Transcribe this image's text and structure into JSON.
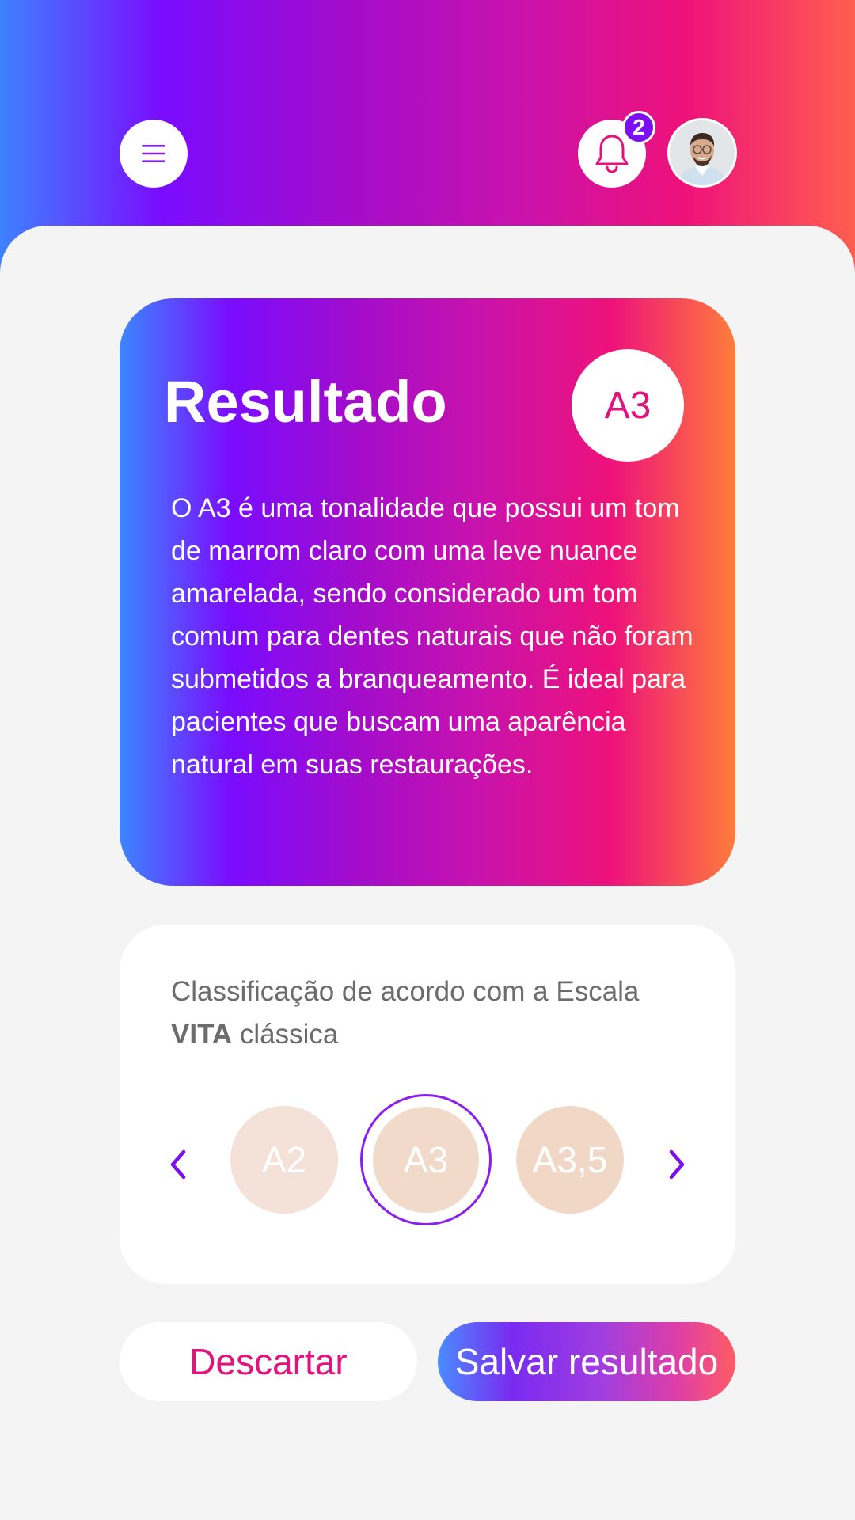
{
  "header": {
    "menu_icon": "hamburger-menu-icon",
    "notification_icon": "bell-icon",
    "notification_count": "2",
    "avatar": "user-avatar"
  },
  "result": {
    "title": "Resultado",
    "shade": "A3",
    "description": "O A3 é uma tonalidade que possui um tom de marrom claro com uma leve nuance amarelada, sendo considerado um tom comum para dentes naturais que não foram submetidos a branqueamento. É ideal para pacientes que buscam uma aparência natural em suas restaurações."
  },
  "scale": {
    "text_before": "Classificação de acordo com a Escala ",
    "text_bold": "VITA",
    "text_after": " clássica",
    "shades": [
      "A2",
      "A3",
      "A3,5"
    ],
    "selected": "A3",
    "prev_icon": "chevron-left-icon",
    "next_icon": "chevron-right-icon"
  },
  "actions": {
    "discard_label": "Descartar",
    "save_label": "Salvar resultado"
  },
  "colors": {
    "accent_pink": "#e4127c",
    "accent_purple": "#7a10f0",
    "background": "#f4f4f4"
  }
}
